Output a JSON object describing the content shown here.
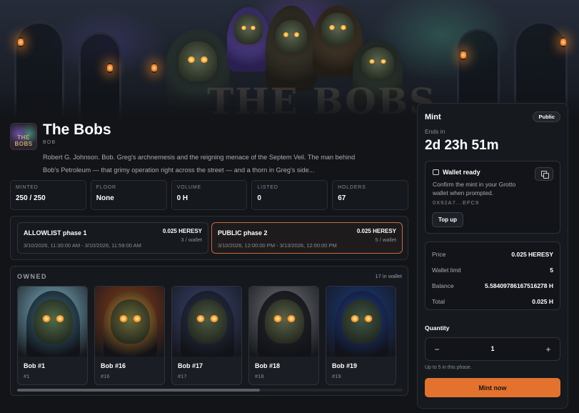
{
  "collection": {
    "name": "The Bobs",
    "symbol": "BOB",
    "avatar_text": "THE BOBS",
    "banner_watermark": "THE BOBS",
    "description": "Robert G. Johnson. Bob. Greg's archnemesis and the reigning menace of the Septem Veil. The man behind Bob's Petroleum — that grimy operation right across the street — and a thorn in Greg's side..."
  },
  "stats": [
    {
      "label": "MINTED",
      "value": "250 / 250"
    },
    {
      "label": "FLOOR",
      "value": "None"
    },
    {
      "label": "VOLUME",
      "value": "0 H"
    },
    {
      "label": "LISTED",
      "value": "0"
    },
    {
      "label": "HOLDERS",
      "value": "67"
    }
  ],
  "phases": [
    {
      "name": "ALLOWLIST phase 1",
      "price": "0.025 HERESY",
      "limit": "3 / wallet",
      "dates": "3/10/2026, 11:30:00 AM - 3/10/2026, 11:59:00 AM",
      "active": false
    },
    {
      "name": "PUBLIC phase 2",
      "price": "0.025 HERESY",
      "limit": "5 / wallet",
      "dates": "3/10/2026, 12:00:00 PM - 3/13/2026, 12:00:00 PM",
      "active": true
    }
  ],
  "owned": {
    "heading": "OWNED",
    "count": "17 in wallet",
    "items": [
      {
        "name": "Bob #1",
        "id": "#1",
        "bg": "#7fb6c8",
        "hood": "#3d6f86",
        "skin": "#4f6a48"
      },
      {
        "name": "Bob #16",
        "id": "#16",
        "bg": "#8a3c18",
        "hood": "#d4882a",
        "skin": "#6a6a3a"
      },
      {
        "name": "Bob #17",
        "id": "#17",
        "bg": "#3a4470",
        "hood": "#2b3550",
        "skin": "#4d5a44"
      },
      {
        "name": "Bob #18",
        "id": "#18",
        "bg": "#6f7276",
        "hood": "#26272a",
        "skin": "#5b6248"
      },
      {
        "name": "Bob #19",
        "id": "#19",
        "bg": "#1a3a7a",
        "hood": "#1f3f9a",
        "skin": "#3f5646"
      }
    ]
  },
  "mint_panel": {
    "title": "Mint",
    "badge": "Public",
    "ends_label": "Ends in",
    "countdown": "2d 23h 51m",
    "wallet_title": "Wallet ready",
    "wallet_text": "Confirm the mint in your Grotto wallet when prompted.",
    "wallet_address": "0X92A7...EFC9",
    "topup_label": "Top up",
    "rows": [
      {
        "key": "Price",
        "value": "0.025 HERESY"
      },
      {
        "key": "Wallet limit",
        "value": "5"
      },
      {
        "key": "Balance",
        "value": "5.58409786167516278 H"
      },
      {
        "key": "Total",
        "value": "0.025 H"
      }
    ],
    "quantity_label": "Quantity",
    "quantity": "1",
    "minus": "−",
    "plus": "+",
    "hint": "Up to 5 in this phase.",
    "mint_button": "Mint now"
  },
  "colors": {
    "accent": "#e2722e",
    "active_border": "#c86a3a",
    "background": "#121418"
  }
}
